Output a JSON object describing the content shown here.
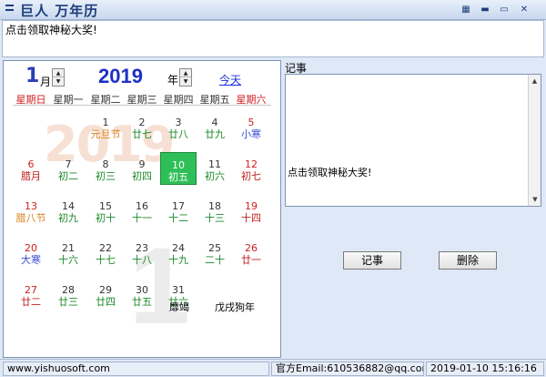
{
  "window": {
    "title": "巨人 万年历",
    "buttons": [
      "▦",
      "▬",
      "▭",
      "✕"
    ]
  },
  "notice_text": "点击领取神秘大奖!",
  "calendar": {
    "month": "1",
    "month_unit": "月",
    "year": "2019",
    "year_unit": "年",
    "today_link": "今天",
    "watermark_year": "2019",
    "watermark_month": "1",
    "weekdays": [
      "星期日",
      "星期一",
      "星期二",
      "星期三",
      "星期四",
      "星期五",
      "星期六"
    ],
    "days": [
      {
        "d": "1",
        "l": "元旦节"
      },
      {
        "d": "2",
        "l": "廿七"
      },
      {
        "d": "3",
        "l": "廿八"
      },
      {
        "d": "4",
        "l": "廿九"
      },
      {
        "d": "5",
        "l": "小寒"
      },
      {
        "d": "6",
        "l": "腊月"
      },
      {
        "d": "7",
        "l": "初二"
      },
      {
        "d": "8",
        "l": "初三"
      },
      {
        "d": "9",
        "l": "初四"
      },
      {
        "d": "10",
        "l": "初五"
      },
      {
        "d": "11",
        "l": "初六"
      },
      {
        "d": "12",
        "l": "初七"
      },
      {
        "d": "13",
        "l": "腊八节"
      },
      {
        "d": "14",
        "l": "初九"
      },
      {
        "d": "15",
        "l": "初十"
      },
      {
        "d": "16",
        "l": "十一"
      },
      {
        "d": "17",
        "l": "十二"
      },
      {
        "d": "18",
        "l": "十三"
      },
      {
        "d": "19",
        "l": "十四"
      },
      {
        "d": "20",
        "l": "大寒"
      },
      {
        "d": "21",
        "l": "十六"
      },
      {
        "d": "22",
        "l": "十七"
      },
      {
        "d": "23",
        "l": "十八"
      },
      {
        "d": "24",
        "l": "十九"
      },
      {
        "d": "25",
        "l": "二十"
      },
      {
        "d": "26",
        "l": "廿一"
      },
      {
        "d": "27",
        "l": "廿二"
      },
      {
        "d": "28",
        "l": "廿三"
      },
      {
        "d": "29",
        "l": "廿四"
      },
      {
        "d": "30",
        "l": "廿五"
      },
      {
        "d": "31",
        "l": "廿六"
      }
    ],
    "selected_day": "10",
    "ganzhi_1": "靡竭",
    "ganzhi_2": "戊戌狗年"
  },
  "notes": {
    "label": "记事",
    "text": "点击领取神秘大奖!",
    "add_label": "记事",
    "delete_label": "删除"
  },
  "status": {
    "website": "www.yishuosoft.com",
    "email": "官方Email:610536882@qq.com",
    "datetime": "2019-01-10 15:16:16"
  },
  "colors": {
    "selected_green": "#2fbf58",
    "weekend_red": "#d22020",
    "lunar_green": "#1d8a2a",
    "festival_orange": "#d8841c",
    "solar_term_blue": "#3a4fd0",
    "year_blue": "#1d2fc7"
  }
}
